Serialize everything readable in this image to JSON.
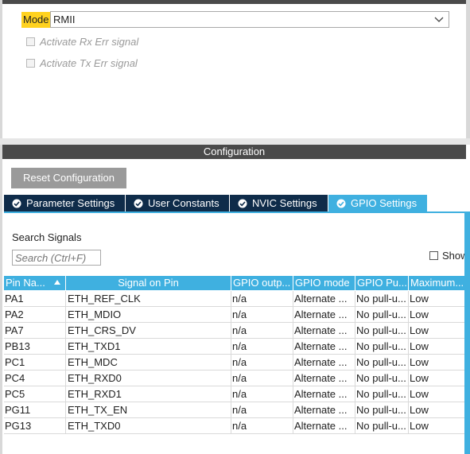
{
  "mode": {
    "label": "Mode",
    "value": "RMII",
    "options": [
      {
        "label": "Activate Rx Err signal",
        "checked": false
      },
      {
        "label": "Activate Tx Err signal",
        "checked": false
      }
    ]
  },
  "configuration": {
    "title": "Configuration",
    "reset_label": "Reset Configuration"
  },
  "tabs": [
    {
      "label": "Parameter Settings",
      "active": false
    },
    {
      "label": "User Constants",
      "active": false
    },
    {
      "label": "NVIC Settings",
      "active": false
    },
    {
      "label": "GPIO Settings",
      "active": true
    }
  ],
  "search": {
    "label": "Search Signals",
    "placeholder": "Search (Ctrl+F)",
    "show_label": "Show"
  },
  "table": {
    "columns": [
      "Pin Na...",
      "Signal on Pin",
      "GPIO outp...",
      "GPIO mode",
      "GPIO Pu...",
      "Maximum..."
    ],
    "rows": [
      [
        "PA1",
        "ETH_REF_CLK",
        "n/a",
        "Alternate ...",
        "No pull-u...",
        "Low"
      ],
      [
        "PA2",
        "ETH_MDIO",
        "n/a",
        "Alternate ...",
        "No pull-u...",
        "Low"
      ],
      [
        "PA7",
        "ETH_CRS_DV",
        "n/a",
        "Alternate ...",
        "No pull-u...",
        "Low"
      ],
      [
        "PB13",
        "ETH_TXD1",
        "n/a",
        "Alternate ...",
        "No pull-u...",
        "Low"
      ],
      [
        "PC1",
        "ETH_MDC",
        "n/a",
        "Alternate ...",
        "No pull-u...",
        "Low"
      ],
      [
        "PC4",
        "ETH_RXD0",
        "n/a",
        "Alternate ...",
        "No pull-u...",
        "Low"
      ],
      [
        "PC5",
        "ETH_RXD1",
        "n/a",
        "Alternate ...",
        "No pull-u...",
        "Low"
      ],
      [
        "PG11",
        "ETH_TX_EN",
        "n/a",
        "Alternate ...",
        "No pull-u...",
        "Low"
      ],
      [
        "PG13",
        "ETH_TXD0",
        "n/a",
        "Alternate ...",
        "No pull-u...",
        "Low"
      ]
    ]
  },
  "colors": {
    "accent": "#3fb0e0",
    "tab_dark": "#0f2c4a",
    "header_dark": "#4a4a4a",
    "highlight": "#ffd21f"
  }
}
